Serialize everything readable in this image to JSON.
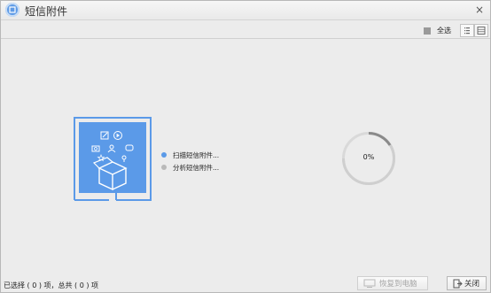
{
  "window": {
    "title": "短信附件",
    "close_symbol": "×",
    "app_icon": "sms-attachment-app-icon"
  },
  "toolbar": {
    "select_all_label": "全选",
    "view_list_icon": "list-view-icon",
    "view_grid_icon": "grid-view-icon"
  },
  "scan": {
    "steps": [
      {
        "label": "扫描短信附件...",
        "state": "active"
      },
      {
        "label": "分析短信附件...",
        "state": "pending"
      }
    ],
    "progress": {
      "text": "0%",
      "value": 0
    },
    "colors": {
      "accent": "#5b9ae8",
      "idle": "#b9b9b9"
    }
  },
  "footer": {
    "summary": "已选择 ( 0 ) 项，总共 ( 0 ) 项",
    "restore_label": "恢复到电脑",
    "close_label": "关闭"
  }
}
